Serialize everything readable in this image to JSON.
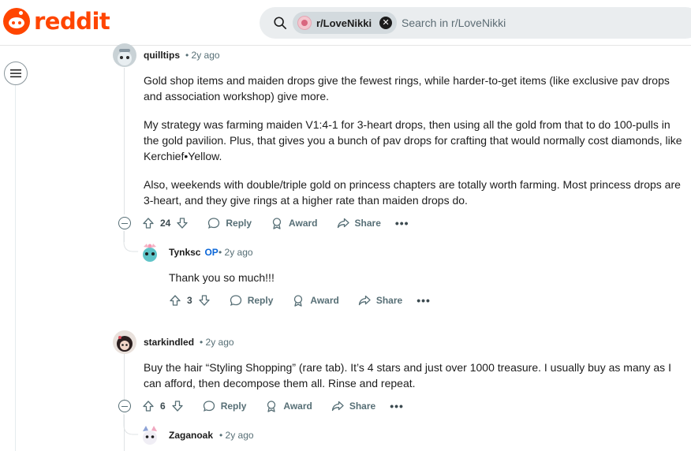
{
  "header": {
    "logo_text": "reddit",
    "search_chip": "r/LoveNikki",
    "search_placeholder": "Search in r/LoveNikki"
  },
  "comments": [
    {
      "author": "quilltips",
      "time": "• 2y ago",
      "paragraphs": [
        "Gold shop items and maiden drops give the fewest rings, while harder-to-get items (like exclusive pav drops and association workshop) give more.",
        "My strategy was farming maiden V1:4-1 for 3-heart drops, then using all the gold from that to do 100-pulls in the gold pavilion. Plus, that gives you a bunch of pav drops for crafting that would normally cost diamonds, like Kerchief•Yellow.",
        "Also, weekends with double/triple gold on princess chapters are totally worth farming. Most princess drops are 3-heart, and they give rings at a higher rate than maiden drops do."
      ],
      "votes": "24",
      "reply": "Reply",
      "award": "Award",
      "share": "Share",
      "more": "•••"
    },
    {
      "author": "Tynksc",
      "op_badge": "OP",
      "time": "• 2y ago",
      "paragraphs": [
        "Thank you so much!!!"
      ],
      "votes": "3",
      "reply": "Reply",
      "award": "Award",
      "share": "Share",
      "more": "•••"
    },
    {
      "author": "starkindled",
      "time": "• 2y ago",
      "paragraphs": [
        "Buy the hair “Styling Shopping” (rare tab). It’s 4 stars and just over 1000 treasure. I usually buy as many as I can afford, then decompose them all. Rinse and repeat."
      ],
      "votes": "6",
      "reply": "Reply",
      "award": "Award",
      "share": "Share",
      "more": "•••"
    },
    {
      "author": "Zaganoak",
      "time": "• 2y ago"
    }
  ],
  "colors": {
    "brand": "#ff4500",
    "op": "#0a66d8",
    "meta": "#576f76"
  }
}
